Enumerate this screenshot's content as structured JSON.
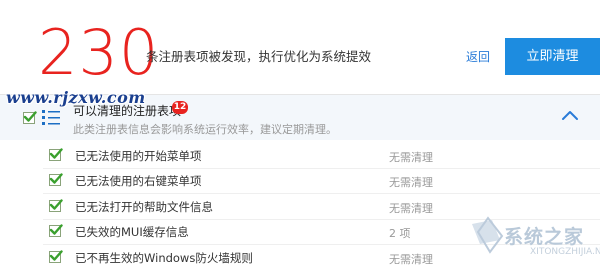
{
  "header": {
    "count": "230",
    "summary": "条注册表项被发现，执行优化为系统提效",
    "back_label": "返回",
    "clean_label": "立即清理",
    "accent_color": "#e8231f",
    "button_color": "#1d8ce0"
  },
  "watermark": {
    "site": "www.rjzxw.com",
    "logo_text": "系统之家",
    "logo_url": "XITONGZHIJIA.NET"
  },
  "group": {
    "title": "可以清理的注册表项",
    "badge": "12",
    "description": "此类注册表信息会影响系统运行效率，建议定期清理。",
    "checked": true,
    "expanded": true
  },
  "items": [
    {
      "label": "已无法使用的开始菜单项",
      "status": "无需清理",
      "checked": true
    },
    {
      "label": "已无法使用的右键菜单项",
      "status": "无需清理",
      "checked": true
    },
    {
      "label": "已无法打开的帮助文件信息",
      "status": "无需清理",
      "checked": true
    },
    {
      "label": "已失效的MUI缓存信息",
      "status": "2 项",
      "checked": true
    },
    {
      "label": "已不再生效的Windows防火墙规则",
      "status": "无需清理",
      "checked": true
    }
  ]
}
